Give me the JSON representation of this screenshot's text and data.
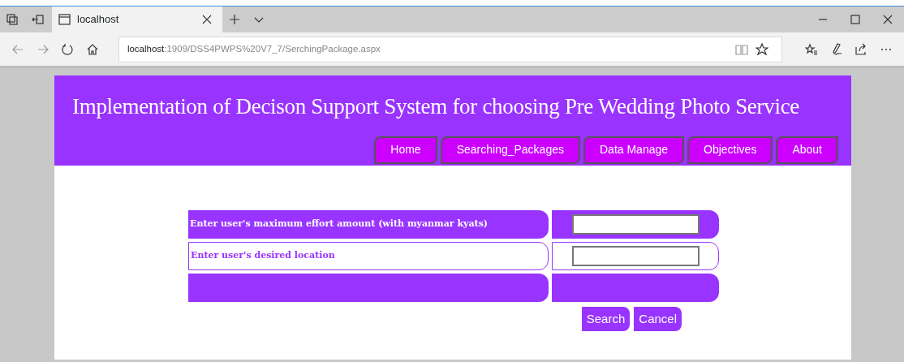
{
  "browser": {
    "tab": {
      "title": "localhost"
    },
    "address": {
      "host": "localhost",
      "path": ":1909/DSS4PWPS%20V7_7/SerchingPackage.aspx"
    }
  },
  "header": {
    "title": "Implementation of Decison Support System for choosing Pre Wedding Photo Service"
  },
  "nav": [
    "Home",
    "Searching_Packages",
    "Data Manage",
    "Objectives",
    "About"
  ],
  "form": {
    "rows": [
      {
        "kind": "filled",
        "label": "Enter user's maximum effort amount (with myanmar kyats)",
        "field": true
      },
      {
        "kind": "outlined",
        "label": "Enter user's desired location",
        "field": true
      },
      {
        "kind": "filled",
        "field": false
      }
    ],
    "buttons": [
      "Search",
      "Cancel"
    ]
  }
}
